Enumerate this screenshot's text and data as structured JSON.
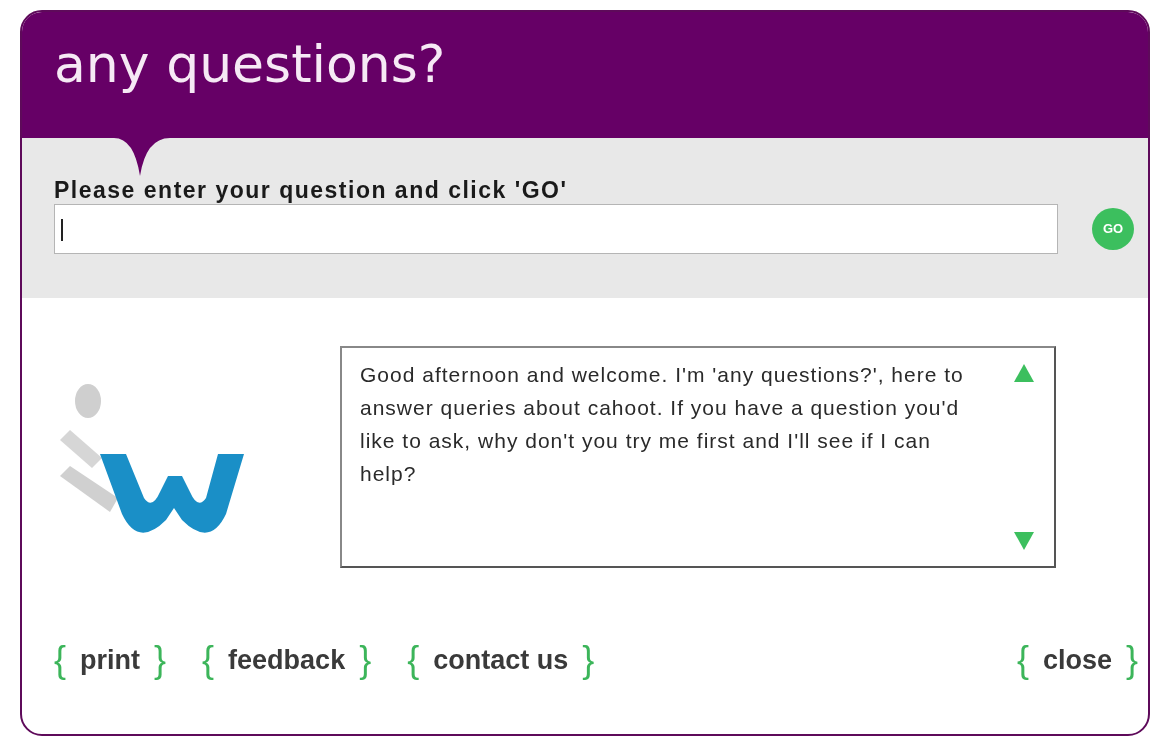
{
  "window": {
    "title": "any questions?"
  },
  "question": {
    "label": "Please enter your question and click 'GO'",
    "button": "GO"
  },
  "answer": {
    "text": "Good afternoon and welcome. I'm 'any questions?', here to answer queries about cahoot. If you have a question you'd like to ask, why don't you try me first and I'll see if I can help?"
  },
  "footer": {
    "left_links": [
      {
        "open": "{",
        "label": "print",
        "close": "}"
      },
      {
        "open": "{",
        "label": "feedback",
        "close": "}"
      },
      {
        "open": "{",
        "label": "contact us",
        "close": "}"
      }
    ],
    "right_links": [
      {
        "open": "{",
        "label": "close",
        "close": "}"
      }
    ]
  }
}
